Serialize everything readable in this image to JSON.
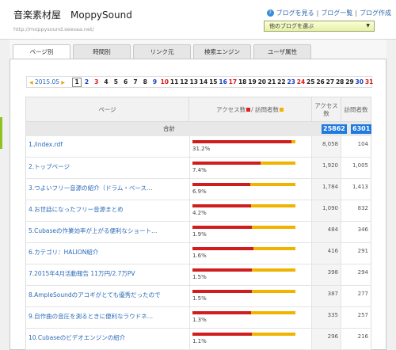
{
  "header": {
    "site_title": "音楽素材屋　MoppySound",
    "site_url": "http://moppysound.seesaa.net/",
    "link_view": "ブログを見る",
    "link_list": "ブログ一覧",
    "link_create": "ブログ作成",
    "blog_select": "他のブログを選ぶ"
  },
  "tabs": [
    "ページ別",
    "時間別",
    "リンク元",
    "検索エンジン",
    "ユーザ属性"
  ],
  "date_nav": {
    "month": "2015.05",
    "days": [
      "1",
      "2",
      "3",
      "4",
      "5",
      "6",
      "7",
      "8",
      "9",
      "10",
      "11",
      "12",
      "13",
      "14",
      "15",
      "16",
      "17",
      "18",
      "19",
      "20",
      "21",
      "22",
      "23",
      "24",
      "25",
      "26",
      "27",
      "28",
      "29",
      "30",
      "31"
    ],
    "selected_day": "1",
    "saturday_days": [
      "2",
      "9",
      "16",
      "23",
      "30"
    ],
    "sunday_days": [
      "3",
      "10",
      "17",
      "24",
      "31"
    ]
  },
  "table": {
    "headers": {
      "page": "ページ",
      "bar": "アクセス数",
      "bar_sep": "/ 訪問者数",
      "access": "アクセス数",
      "visitors": "訪問者数"
    },
    "total": {
      "label": "合計",
      "access": "25862",
      "visitors": "6301"
    },
    "rows": [
      {
        "title": "1./index.rdf",
        "pct": "31.2%",
        "access": "8,058",
        "visitors": "104",
        "access_frac": 0.96
      },
      {
        "title": "2.トップページ",
        "pct": "7.4%",
        "access": "1,920",
        "visitors": "1,005",
        "access_frac": 0.66
      },
      {
        "title": "3.つよいフリー音源の紹介（ドラム・ベース…",
        "pct": "6.9%",
        "access": "1,784",
        "visitors": "1,413",
        "access_frac": 0.56
      },
      {
        "title": "4.お世話になったフリー音源まとめ",
        "pct": "4.2%",
        "access": "1,090",
        "visitors": "832",
        "access_frac": 0.57
      },
      {
        "title": "5.Cubaseの作業効率が上がる便利なショート…",
        "pct": "1.9%",
        "access": "484",
        "visitors": "346",
        "access_frac": 0.58
      },
      {
        "title": "6.カテゴリ：HALION紹介",
        "pct": "1.6%",
        "access": "416",
        "visitors": "291",
        "access_frac": 0.59
      },
      {
        "title": "7.2015年4月活動報告 11万円/2.7万PV",
        "pct": "1.5%",
        "access": "398",
        "visitors": "294",
        "access_frac": 0.58
      },
      {
        "title": "8.AmpleSoundのアコギがとても優秀だったので",
        "pct": "1.5%",
        "access": "387",
        "visitors": "277",
        "access_frac": 0.58
      },
      {
        "title": "9.自作曲の音圧を測るときに便利なラウドネ…",
        "pct": "1.3%",
        "access": "335",
        "visitors": "257",
        "access_frac": 0.57
      },
      {
        "title": "10.Cubaseのビデオエンジンの紹介",
        "pct": "1.1%",
        "access": "296",
        "visitors": "216",
        "access_frac": 0.58
      }
    ]
  },
  "colors": {
    "access": "#d01e1e",
    "visitors": "#f0b400",
    "link": "#2a6ab8",
    "highlight": "#1f7ae0"
  }
}
